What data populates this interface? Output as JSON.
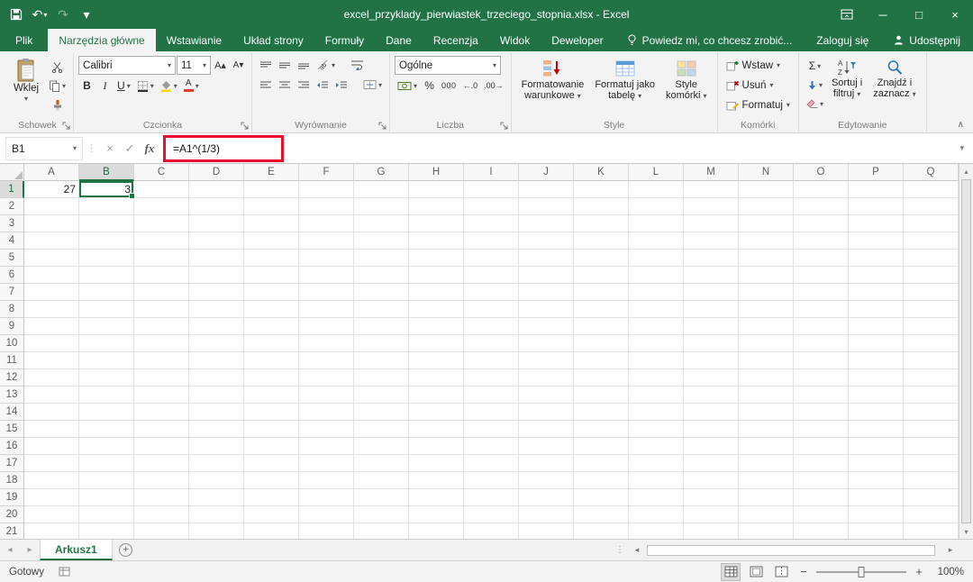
{
  "glyphs": {
    "dropdown": "▾",
    "undo": "↶",
    "redo": "↷",
    "minimize": "─",
    "maximize": "□",
    "close": "×",
    "cancel": "×",
    "check": "✓",
    "fx": "fx",
    "bold": "B",
    "italic": "I",
    "underline": "U",
    "sum": "Σ",
    "percent": "%",
    "thousands": "000",
    "inc_decimal": "←.0",
    "dec_decimal": ".00→",
    "font_bigger": "A▴",
    "font_smaller": "A▾",
    "collapse": "∧",
    "prev": "◂",
    "next": "▸",
    "up": "▴",
    "down": "▾",
    "add": "+",
    "minus": "−",
    "plus": "+",
    "splitter": "⋮"
  },
  "titlebar": {
    "title": "excel_przyklady_pierwiastek_trzeciego_stopnia.xlsx - Excel"
  },
  "tabs": {
    "file": "Plik",
    "items": [
      {
        "label": "Narzędzia główne",
        "active": true
      },
      {
        "label": "Wstawianie",
        "active": false
      },
      {
        "label": "Układ strony",
        "active": false
      },
      {
        "label": "Formuły",
        "active": false
      },
      {
        "label": "Dane",
        "active": false
      },
      {
        "label": "Recenzja",
        "active": false
      },
      {
        "label": "Widok",
        "active": false
      },
      {
        "label": "Deweloper",
        "active": false
      }
    ],
    "tell_me": "Powiedz mi, co chcesz zrobić...",
    "sign_in": "Zaloguj się",
    "share": "Udostępnij"
  },
  "ribbon": {
    "clipboard": {
      "label": "Schowek",
      "paste": "Wklej"
    },
    "font": {
      "label": "Czcionka",
      "family": "Calibri",
      "size": "11"
    },
    "alignment": {
      "label": "Wyrównanie"
    },
    "number": {
      "label": "Liczba",
      "format": "Ogólne"
    },
    "styles": {
      "label": "Style",
      "conditional_1": "Formatowanie",
      "conditional_2": "warunkowe",
      "table_1": "Formatuj jako",
      "table_2": "tabelę",
      "cell_1": "Style",
      "cell_2": "komórki"
    },
    "cells": {
      "label": "Komórki",
      "insert": "Wstaw",
      "delete": "Usuń",
      "format": "Formatuj"
    },
    "editing": {
      "label": "Edytowanie",
      "sort_1": "Sortuj i",
      "sort_2": "filtruj",
      "find_1": "Znajdź i",
      "find_2": "zaznacz"
    }
  },
  "formula_bar": {
    "name_box": "B1",
    "formula": "=A1^(1/3)"
  },
  "grid": {
    "columns": [
      "A",
      "B",
      "C",
      "D",
      "E",
      "F",
      "G",
      "H",
      "I",
      "J",
      "K",
      "L",
      "M",
      "N",
      "O",
      "P",
      "Q"
    ],
    "row_count": 21,
    "cells": {
      "A1": "27",
      "B1": "3"
    },
    "selection": {
      "cell": "B1",
      "column": "B",
      "row": "1"
    }
  },
  "sheet_bar": {
    "tabs": [
      {
        "name": "Arkusz1",
        "active": true
      }
    ]
  },
  "status_bar": {
    "mode": "Gotowy",
    "zoom": "100%"
  },
  "colors": {
    "accent": "#217346",
    "selection_border": "#217346",
    "highlight_box": "#e8112d"
  }
}
